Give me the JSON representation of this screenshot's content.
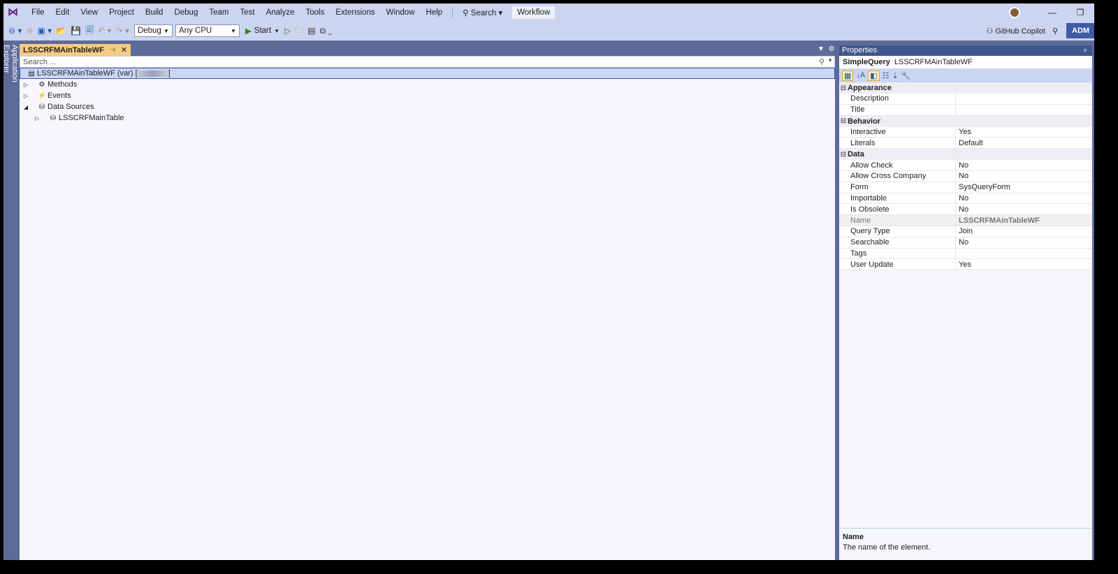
{
  "menu": [
    "File",
    "Edit",
    "View",
    "Project",
    "Build",
    "Debug",
    "Team",
    "Test",
    "Analyze",
    "Tools",
    "Extensions",
    "Window",
    "Help"
  ],
  "search_label": "Search",
  "workflow_label": "Workflow",
  "toolbar": {
    "config": "Debug",
    "platform": "Any CPU",
    "start": "Start",
    "copilot": "GitHub Copilot",
    "account": "ADM"
  },
  "side_tab": "Application Explorer",
  "doc_tab": {
    "title": "LSSCRFMAinTableWF"
  },
  "explorer": {
    "search_placeholder": "Search ...",
    "root": "LSSCRFMAinTableWF (var) [",
    "root_end": "]",
    "items": [
      {
        "label": "Methods",
        "icon": "methods-icon"
      },
      {
        "label": "Events",
        "icon": "lightning-icon"
      },
      {
        "label": "Data Sources",
        "icon": "database-icon"
      }
    ],
    "child": "LSSCRFMainTable"
  },
  "properties": {
    "title": "Properties",
    "object_type": "SimpleQuery",
    "object_name": "LSSCRFMAinTableWF",
    "categories": [
      {
        "name": "Appearance",
        "rows": [
          {
            "n": "Description",
            "v": ""
          },
          {
            "n": "Title",
            "v": ""
          }
        ]
      },
      {
        "name": "Behavior",
        "rows": [
          {
            "n": "Interactive",
            "v": "Yes"
          },
          {
            "n": "Literals",
            "v": "Default"
          }
        ]
      },
      {
        "name": "Data",
        "rows": [
          {
            "n": "Allow Check",
            "v": "No"
          },
          {
            "n": "Allow Cross Company",
            "v": "No"
          },
          {
            "n": "Form",
            "v": "SysQueryForm"
          },
          {
            "n": "Importable",
            "v": "No"
          },
          {
            "n": "Is Obsolete",
            "v": "No"
          },
          {
            "n": "Name",
            "v": "LSSCRFMAinTableWF",
            "readonly": true
          },
          {
            "n": "Query Type",
            "v": "Join"
          },
          {
            "n": "Searchable",
            "v": "No"
          },
          {
            "n": "Tags",
            "v": ""
          },
          {
            "n": "User Update",
            "v": "Yes"
          }
        ]
      }
    ],
    "desc_title": "Name",
    "desc_text": "The name of the element."
  },
  "colors": {
    "menubar": "#ccd5f0",
    "frame": "#5d6b99",
    "active_tab": "#f5cc84",
    "panel_title": "#40568d"
  }
}
